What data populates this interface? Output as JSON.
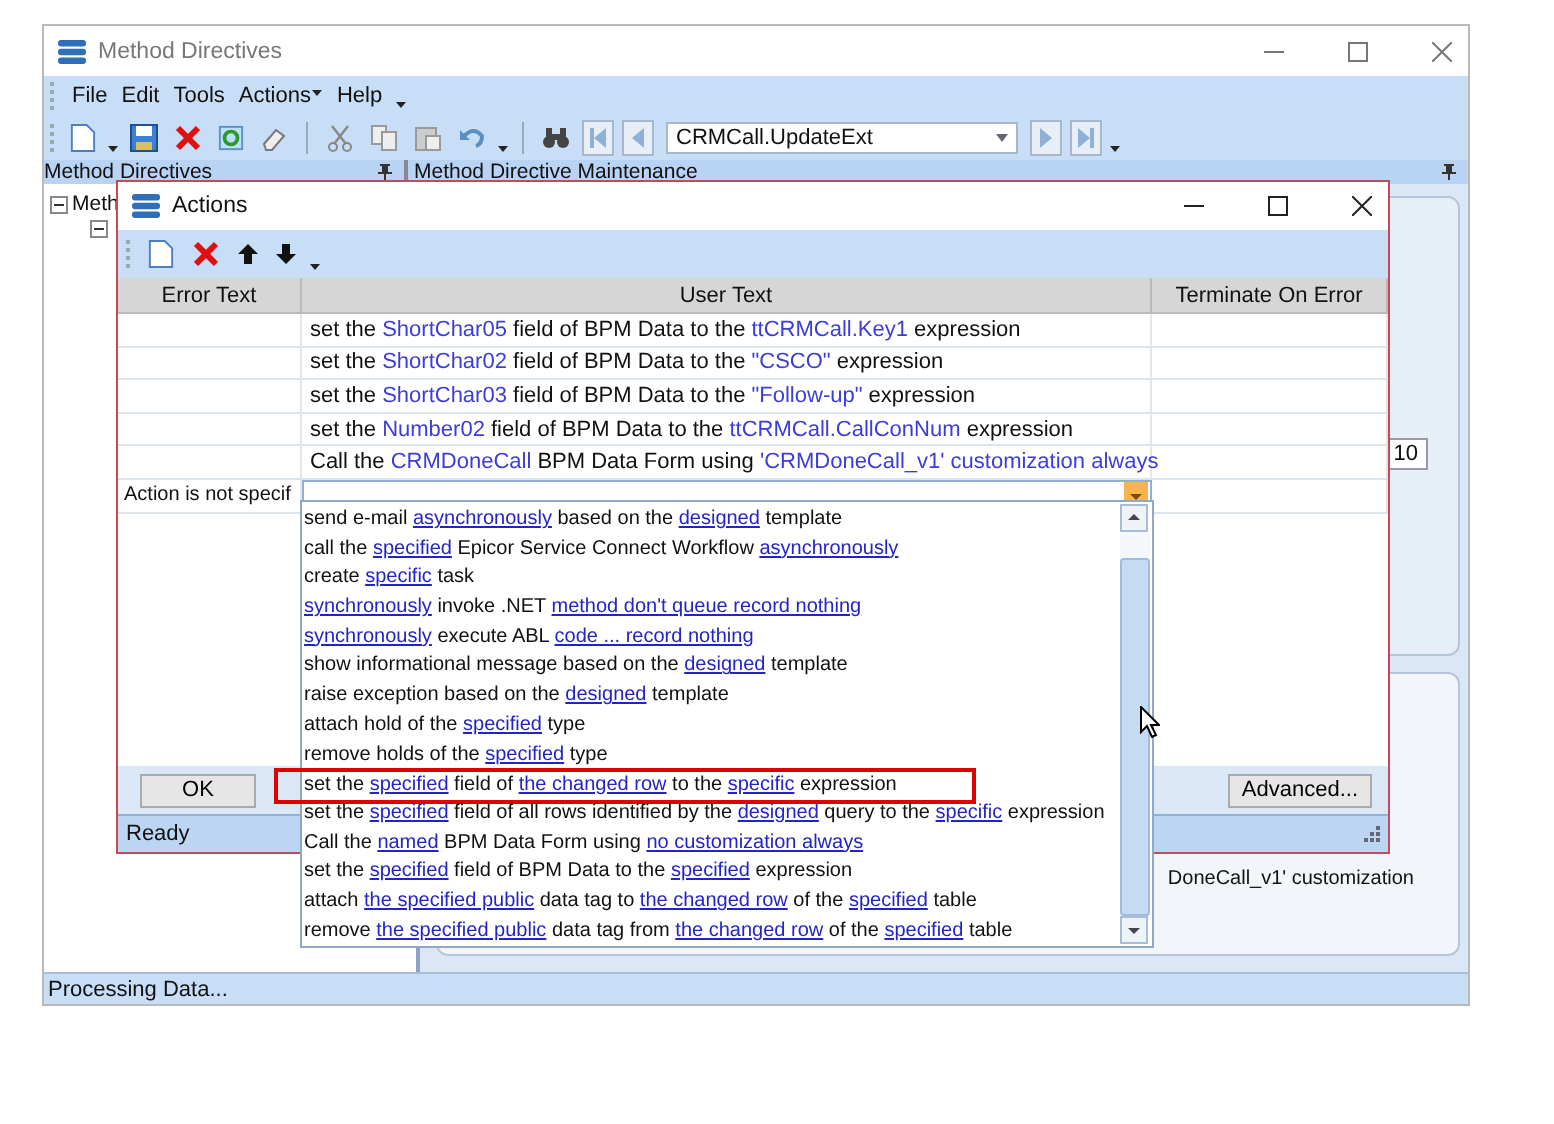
{
  "window": {
    "title": "Method Directives"
  },
  "menu": [
    {
      "label": "File",
      "kind": "plain"
    },
    {
      "label": "Edit",
      "kind": "plain"
    },
    {
      "label": "Tools",
      "kind": "plain"
    },
    {
      "label": "Actions",
      "kind": "dropdown"
    },
    {
      "label": "Help",
      "kind": "plain"
    }
  ],
  "toolbar": {
    "directive": "CRMCall.UpdateExt"
  },
  "panes": {
    "left_title": "Method Directives",
    "right_title": "Method Directive Maintenance"
  },
  "tree": [
    {
      "label": "Meth",
      "expanded": true
    }
  ],
  "background": {
    "field_value": "10",
    "note": "DoneCall_v1' customization"
  },
  "status_bar": "Processing Data...",
  "dialog": {
    "title": "Actions",
    "columns": [
      "Error Text",
      "User Text",
      "Terminate On Error"
    ],
    "rows": [
      {
        "segments": [
          {
            "text": "set the ",
            "param": false
          },
          {
            "text": "ShortChar05",
            "param": true
          },
          {
            "text": " field of BPM Data to the ",
            "param": false
          },
          {
            "text": "ttCRMCall.Key1",
            "param": true
          },
          {
            "text": " expression",
            "param": false
          }
        ]
      },
      {
        "segments": [
          {
            "text": "set the ",
            "param": false
          },
          {
            "text": "ShortChar02",
            "param": true
          },
          {
            "text": " field of BPM Data to the ",
            "param": false
          },
          {
            "text": "\"CSCO\"",
            "param": true
          },
          {
            "text": " expression",
            "param": false
          }
        ]
      },
      {
        "segments": [
          {
            "text": "set the ",
            "param": false
          },
          {
            "text": "ShortChar03",
            "param": true
          },
          {
            "text": " field of BPM Data to the ",
            "param": false
          },
          {
            "text": "\"Follow-up\"",
            "param": true
          },
          {
            "text": " expression",
            "param": false
          }
        ]
      },
      {
        "segments": [
          {
            "text": "set the ",
            "param": false
          },
          {
            "text": "Number02",
            "param": true
          },
          {
            "text": " field of BPM Data to the ",
            "param": false
          },
          {
            "text": "ttCRMCall.CallConNum",
            "param": true
          },
          {
            "text": " expression",
            "param": false
          }
        ]
      },
      {
        "segments": [
          {
            "text": "Call the ",
            "param": false
          },
          {
            "text": "CRMDoneCall",
            "param": true
          },
          {
            "text": " BPM Data Form using ",
            "param": false
          },
          {
            "text": "'CRMDoneCall_v1' customization always",
            "param": true
          }
        ]
      }
    ],
    "new_row": {
      "error_text": "Action is not specif"
    },
    "options": [
      {
        "highlighted": false,
        "segments": [
          {
            "text": "send e-mail ",
            "link": false
          },
          {
            "text": "asynchronously",
            "link": true
          },
          {
            "text": " based on the ",
            "link": false
          },
          {
            "text": "designed",
            "link": true
          },
          {
            "text": " template",
            "link": false
          }
        ]
      },
      {
        "highlighted": false,
        "segments": [
          {
            "text": "call the ",
            "link": false
          },
          {
            "text": "specified",
            "link": true
          },
          {
            "text": " Epicor Service Connect Workflow ",
            "link": false
          },
          {
            "text": "asynchronously",
            "link": true
          }
        ]
      },
      {
        "highlighted": false,
        "segments": [
          {
            "text": "create ",
            "link": false
          },
          {
            "text": "specific",
            "link": true
          },
          {
            "text": " task",
            "link": false
          }
        ]
      },
      {
        "highlighted": false,
        "segments": [
          {
            "text": "synchronously",
            "link": true
          },
          {
            "text": " invoke .NET ",
            "link": false
          },
          {
            "text": "method don't queue record nothing",
            "link": true
          }
        ]
      },
      {
        "highlighted": false,
        "segments": [
          {
            "text": "synchronously",
            "link": true
          },
          {
            "text": " execute ABL ",
            "link": false
          },
          {
            "text": "code ... record nothing",
            "link": true
          }
        ]
      },
      {
        "highlighted": false,
        "segments": [
          {
            "text": "show informational message based on the ",
            "link": false
          },
          {
            "text": "designed",
            "link": true
          },
          {
            "text": " template",
            "link": false
          }
        ]
      },
      {
        "highlighted": false,
        "segments": [
          {
            "text": "raise exception based on the ",
            "link": false
          },
          {
            "text": "designed",
            "link": true
          },
          {
            "text": " template",
            "link": false
          }
        ]
      },
      {
        "highlighted": false,
        "segments": [
          {
            "text": "attach hold of the ",
            "link": false
          },
          {
            "text": "specified",
            "link": true
          },
          {
            "text": " type",
            "link": false
          }
        ]
      },
      {
        "highlighted": false,
        "segments": [
          {
            "text": "remove holds of the ",
            "link": false
          },
          {
            "text": "specified",
            "link": true
          },
          {
            "text": " type",
            "link": false
          }
        ]
      },
      {
        "highlighted": true,
        "segments": [
          {
            "text": "set the ",
            "link": false
          },
          {
            "text": "specified",
            "link": true
          },
          {
            "text": " field of ",
            "link": false
          },
          {
            "text": "the changed row",
            "link": true
          },
          {
            "text": " to the ",
            "link": false
          },
          {
            "text": "specific",
            "link": true
          },
          {
            "text": " expression",
            "link": false
          }
        ]
      },
      {
        "highlighted": false,
        "segments": [
          {
            "text": "set the ",
            "link": false
          },
          {
            "text": "specified",
            "link": true
          },
          {
            "text": " field of all rows identified by the ",
            "link": false
          },
          {
            "text": "designed",
            "link": true
          },
          {
            "text": " query to the ",
            "link": false
          },
          {
            "text": "specific",
            "link": true
          },
          {
            "text": " expression",
            "link": false
          }
        ]
      },
      {
        "highlighted": false,
        "segments": [
          {
            "text": "Call the ",
            "link": false
          },
          {
            "text": "named",
            "link": true
          },
          {
            "text": " BPM Data Form using ",
            "link": false
          },
          {
            "text": "no customization always",
            "link": true
          }
        ]
      },
      {
        "highlighted": false,
        "segments": [
          {
            "text": "set the ",
            "link": false
          },
          {
            "text": "specified",
            "link": true
          },
          {
            "text": " field of BPM Data to the ",
            "link": false
          },
          {
            "text": "specified",
            "link": true
          },
          {
            "text": " expression",
            "link": false
          }
        ]
      },
      {
        "highlighted": false,
        "segments": [
          {
            "text": "attach ",
            "link": false
          },
          {
            "text": "the specified public",
            "link": true
          },
          {
            "text": " data tag to ",
            "link": false
          },
          {
            "text": "the changed row",
            "link": true
          },
          {
            "text": " of the ",
            "link": false
          },
          {
            "text": "specified",
            "link": true
          },
          {
            "text": " table",
            "link": false
          }
        ]
      },
      {
        "highlighted": false,
        "segments": [
          {
            "text": "remove ",
            "link": false
          },
          {
            "text": "the specified public",
            "link": true
          },
          {
            "text": " data tag from ",
            "link": false
          },
          {
            "text": "the changed row",
            "link": true
          },
          {
            "text": " of the ",
            "link": false
          },
          {
            "text": "specified",
            "link": true
          },
          {
            "text": " table",
            "link": false
          }
        ]
      }
    ],
    "ok_button": "OK",
    "advanced_button": "Advanced...",
    "status": "Ready"
  }
}
